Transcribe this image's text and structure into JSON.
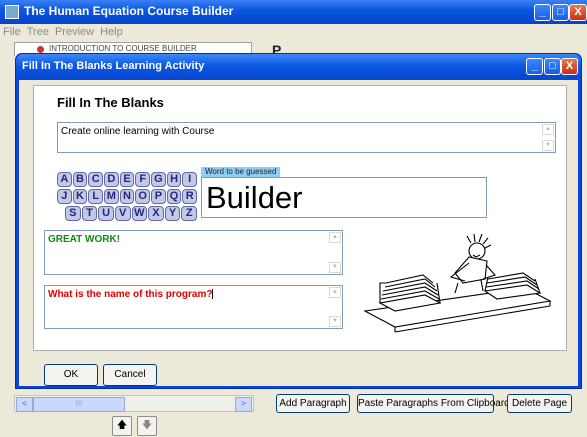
{
  "app": {
    "title": "The Human Equation Course Builder",
    "menu": [
      "File",
      "Tree",
      "Preview",
      "Help"
    ],
    "window_controls": {
      "minimize": "_",
      "maximize": "□",
      "close": "X"
    }
  },
  "tree_peek": "INTRODUCTION TO COURSE BUILDER",
  "main_heading_peek": "P",
  "bottom_bar": {
    "add_paragraph": "Add Paragraph",
    "paste_paragraphs": "Paste Paragraphs From Clipboard",
    "delete_page": "Delete Page",
    "move_up": "🡅",
    "move_down": "🡇",
    "scroll_left": "<",
    "scroll_right": ">",
    "scroll_thumb": "III"
  },
  "dialog": {
    "title": "Fill In The Blanks Learning Activity",
    "heading": "Fill In The Blanks",
    "prompt_text": "Create online learning with Course",
    "letters": [
      [
        "A",
        "B",
        "C",
        "D",
        "E",
        "F",
        "G",
        "H",
        "I"
      ],
      [
        "J",
        "K",
        "L",
        "M",
        "N",
        "O",
        "P",
        "Q",
        "R"
      ],
      [
        "S",
        "T",
        "U",
        "V",
        "W",
        "X",
        "Y",
        "Z"
      ]
    ],
    "word_label": "Word to be guessed",
    "word": "Builder",
    "feedback": "GREAT WORK!",
    "question": "What is the name of this program?",
    "ok": "OK",
    "cancel": "Cancel",
    "colors": {
      "feedback": "#128a12",
      "question": "#e00000",
      "letter_fill": "#c4c8e8",
      "title_bar": "#0c58e2"
    }
  }
}
